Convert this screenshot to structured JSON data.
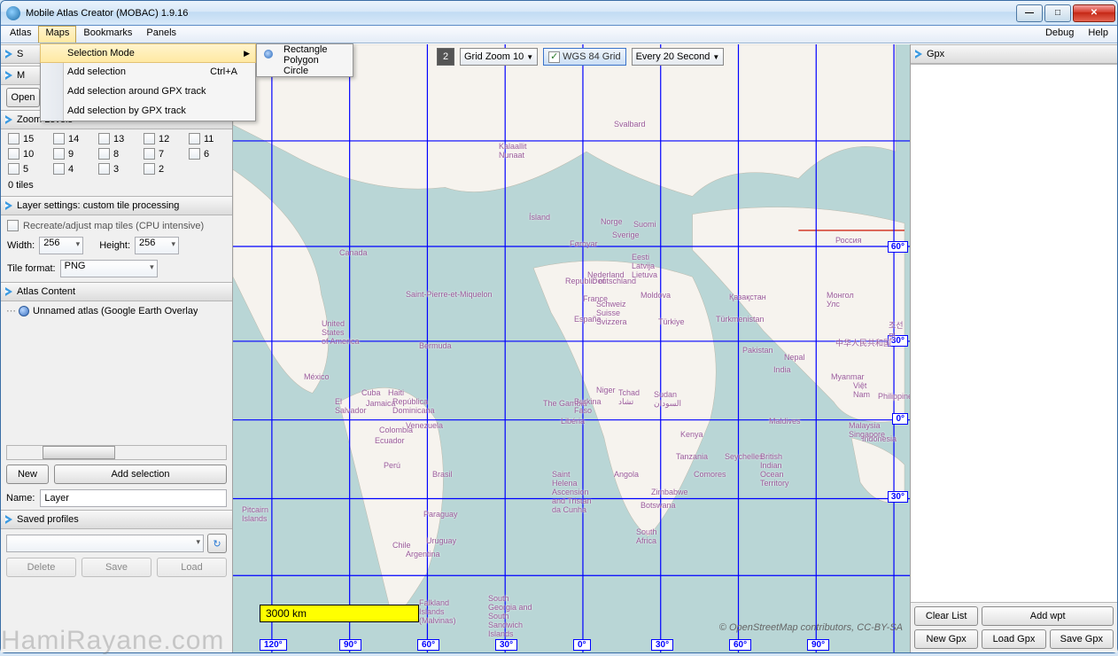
{
  "window": {
    "title": "Mobile Atlas Creator (MOBAC) 1.9.16"
  },
  "menubar": {
    "left": [
      "Atlas",
      "Maps",
      "Bookmarks",
      "Panels"
    ],
    "right": [
      "Debug",
      "Help"
    ],
    "active": "Maps"
  },
  "maps_menu": {
    "items": [
      {
        "label": "Selection Mode",
        "submenu": true,
        "highlight": true
      },
      {
        "label": "Add selection",
        "shortcut": "Ctrl+A"
      },
      {
        "label": "Add selection around GPX track"
      },
      {
        "label": "Add selection by GPX track"
      }
    ],
    "submenu": [
      {
        "label": "Rectangle",
        "selected": true
      },
      {
        "label": "Polygon"
      },
      {
        "label": "Circle"
      }
    ]
  },
  "panels_cut": {
    "top_open_fragment": "Open"
  },
  "zoom_levels": {
    "title": "Zoom Levels",
    "levels": [
      "15",
      "14",
      "13",
      "12",
      "11",
      "10",
      "9",
      "8",
      "7",
      "6",
      "5",
      "4",
      "3",
      "2"
    ],
    "tiles_summary": "0 tiles"
  },
  "layer_settings": {
    "title": "Layer settings: custom tile processing",
    "recreate_label": "Recreate/adjust map tiles (CPU intensive)",
    "width_label": "Width:",
    "width_value": "256",
    "height_label": "Height:",
    "height_value": "256",
    "format_label": "Tile format:",
    "format_value": "PNG"
  },
  "atlas_content": {
    "title": "Atlas Content",
    "root": "Unnamed atlas (Google Earth Overlay",
    "new_btn": "New",
    "add_btn": "Add selection",
    "name_label": "Name:",
    "name_value": "Layer"
  },
  "saved_profiles": {
    "title": "Saved profiles",
    "value": "",
    "delete_btn": "Delete",
    "save_btn": "Save",
    "load_btn": "Load"
  },
  "map_toolbar": {
    "zoom_num": "2",
    "grid_zoom": "Grid Zoom 10",
    "wgs_label": "WGS 84 Grid",
    "wgs_checked": true,
    "interval": "Every 20 Second"
  },
  "map": {
    "scale_text": "3000 km",
    "attribution": "© OpenStreetMap contributors, CC-BY-SA",
    "lat_labels": [
      "60°",
      "30°",
      "0°",
      "30°"
    ],
    "lon_labels": [
      "120°",
      "90°",
      "60°",
      "30°",
      "0°",
      "30°",
      "60°",
      "90°"
    ],
    "places": {
      "kalaallit": "Kalaallit\nNunaat",
      "island": "Ísland",
      "canada": "Canada",
      "usa": "United\nStates\nof America",
      "mexico": "México",
      "cuba": "Cuba",
      "jamaica": "Jamaica",
      "colombia": "Colombia",
      "venezuela": "Venezuela",
      "brasil": "Brasil",
      "peru": "Perú",
      "chile": "Chile",
      "argentina": "Argentina",
      "uruguay": "Uruguay",
      "paraguay": "Paraguay",
      "falkland": "Falkland\nIslands\n(Malvinas)",
      "sgeorgia": "South\nGeorgia and\nSouth\nSandwich\nIslands",
      "norge": "Norge",
      "sverige": "Sverige",
      "suomi": "Suomi",
      "rossiya": "Россия",
      "kazakhstan": "Қазақстан",
      "mongol": "Монгол\nУлс",
      "china": "中华人民共和国",
      "india": "India",
      "nepal": "Nepal",
      "pakistan": "Pakistan",
      "turkiye": "Türkiye",
      "espana": "España",
      "france": "France",
      "deutschland": "Deutschland",
      "schweiz": "Schweiz\nSuisse\nSvizzera",
      "niger": "Niger",
      "tchad": "Tchad\nتشاد",
      "sudan": "Sudan\nالسودان",
      "angola": "Angola",
      "zimbabwe": "Zimbabwe",
      "botswana": "Botswana",
      "southafrica": "South\nAfrica",
      "kenya": "Kenya",
      "tanzania": "Tanzania",
      "seychelles": "Seychelles",
      "maldives": "Maldives",
      "biot": "British\nIndian\nOcean\nTerritory",
      "pitcairn": "Pitcairn\nIslands",
      "svalbard": "Svalbard",
      "faroyar": "Føroyar",
      "stpierre": "Saint-Pierre-et-Miquelon",
      "bermuda": "Bermuda",
      "ecuador": "Ecuador",
      "sthelena": "Saint\nHelena\nAscension\nand Tristan\nda Cunha",
      "indonesia": "Indonesia",
      "malaysia": "Malaysia\nSingapore",
      "philippines": "Philippines",
      "myanmar": "Myanmar",
      "vietnam": "Việt\nNam",
      "joseon": "조선민",
      "elsalvador": "El\nSalvador",
      "haiti": "Haiti",
      "repdom": "República\nDominicana",
      "thegambia": "The Gambia",
      "burkina": "Burkina\nFaso",
      "liberia": "Libéria",
      "comores": "Comores",
      "turkmenistan": "Türkmenistan",
      "moldova": "Moldova",
      "eesti": "Eesti\nLatvija\nLietuva",
      "nederland": "Nederland",
      "republicof": "Republic of"
    }
  },
  "gpx": {
    "title": "Gpx",
    "clear_btn": "Clear List",
    "addwpt_btn": "Add wpt",
    "newgpx_btn": "New Gpx",
    "loadgpx_btn": "Load Gpx",
    "savegpx_btn": "Save Gpx"
  },
  "watermark": "HamiRayane.com"
}
